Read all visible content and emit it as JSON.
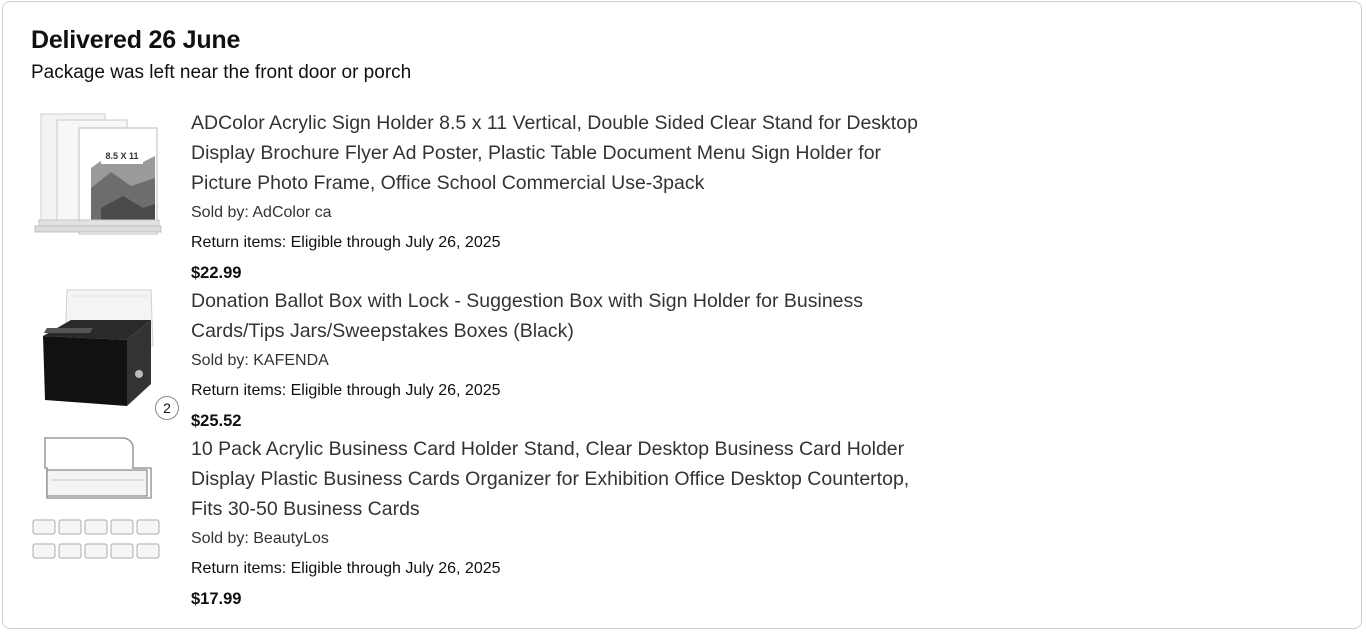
{
  "delivery": {
    "title": "Delivered 26 June",
    "subtitle": "Package was left near the front door or porch"
  },
  "items": [
    {
      "name_lines": [
        "ADColor Acrylic Sign Holder 8.5 x 11 Vertical, Double Sided Clear Stand for Desktop",
        "Display Brochure Flyer Ad Poster, Plastic Table Document Menu Sign Holder for",
        "Picture Photo Frame, Office School Commercial Use-3pack"
      ],
      "seller": "Sold by: AdColor ca",
      "return": "Return items: Eligible through July 26, 2025",
      "price": "$22.99",
      "thumb_label": "8.5 X 11"
    },
    {
      "name_lines": [
        "Donation Ballot Box with Lock - Suggestion Box with Sign Holder for Business",
        "Cards/Tips Jars/Sweepstakes Boxes (Black)"
      ],
      "seller": "Sold by: KAFENDA",
      "return": "Return items: Eligible through July 26, 2025",
      "price": "$25.52",
      "quantity": "2"
    },
    {
      "name_lines": [
        "10 Pack Acrylic Business Card Holder Stand, Clear Desktop Business Card Holder",
        "Display Plastic Business Cards Organizer for Exhibition Office Desktop Countertop,",
        "Fits 30-50 Business Cards"
      ],
      "seller": "Sold by: BeautyLos",
      "return": "Return items: Eligible through July 26, 2025",
      "price": "$17.99"
    }
  ]
}
